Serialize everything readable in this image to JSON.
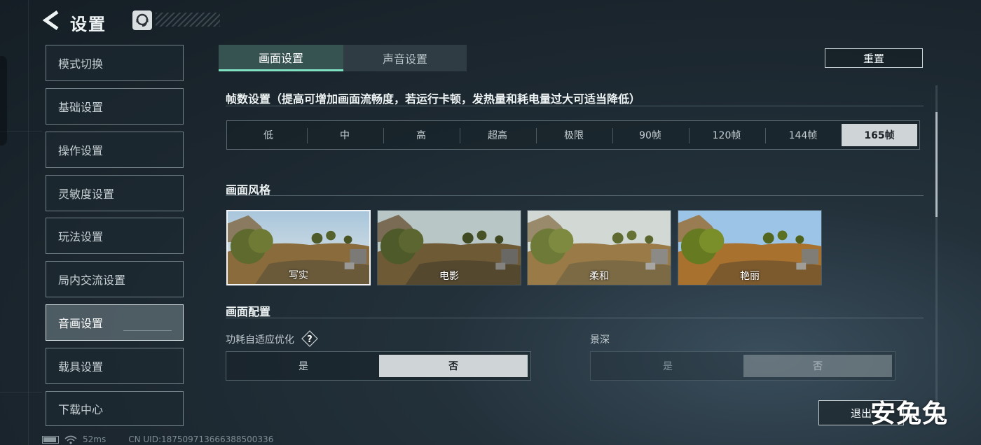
{
  "header": {
    "title": "设置",
    "back_icon": "back-arrow-icon",
    "support_icon": "customer-service-icon"
  },
  "sidebar": {
    "items": [
      {
        "label": "模式切换",
        "active": false
      },
      {
        "label": "基础设置",
        "active": false
      },
      {
        "label": "操作设置",
        "active": false
      },
      {
        "label": "灵敏度设置",
        "active": false
      },
      {
        "label": "玩法设置",
        "active": false
      },
      {
        "label": "局内交流设置",
        "active": false
      },
      {
        "label": "音画设置",
        "active": true
      },
      {
        "label": "载具设置",
        "active": false
      },
      {
        "label": "下载中心",
        "active": false
      }
    ]
  },
  "tabs": [
    {
      "label": "画面设置",
      "active": true
    },
    {
      "label": "声音设置",
      "active": false
    }
  ],
  "reset_label": "重置",
  "frame_rate": {
    "title": "帧数设置（提高可增加画面流畅度，若运行卡顿，发热量和耗电量过大可适当降低）",
    "options": [
      "低",
      "中",
      "高",
      "超高",
      "极限",
      "90帧",
      "120帧",
      "144帧",
      "165帧"
    ],
    "selected": "165帧"
  },
  "visual_style": {
    "title": "画面风格",
    "options": [
      {
        "label": "写实",
        "selected": true
      },
      {
        "label": "电影",
        "selected": false
      },
      {
        "label": "柔和",
        "selected": false
      },
      {
        "label": "艳丽",
        "selected": false
      }
    ]
  },
  "graphics_config": {
    "title": "画面配置",
    "power_adaptive": {
      "label": "功耗自适应优化",
      "help_icon": "question-mark-icon",
      "options": [
        "是",
        "否"
      ],
      "selected": "否"
    },
    "depth_of_field": {
      "label": "景深",
      "options": [
        "是",
        "否"
      ],
      "selected": "否",
      "disabled": true
    }
  },
  "exit_label": "退出",
  "watermark": "安兔兔",
  "status_bar": {
    "battery_icon": "battery-icon",
    "wifi_icon": "wifi-icon",
    "ping": "52ms",
    "uid": "CN UID:18750971366638850033​6",
    "battery_level": 0.9
  },
  "colors": {
    "accent": "#7fe0c2",
    "selected_bg": "#cfd5d7",
    "tab_active_bg": "#3c5a58",
    "sidebar_active_bg": "#5f6e76"
  }
}
